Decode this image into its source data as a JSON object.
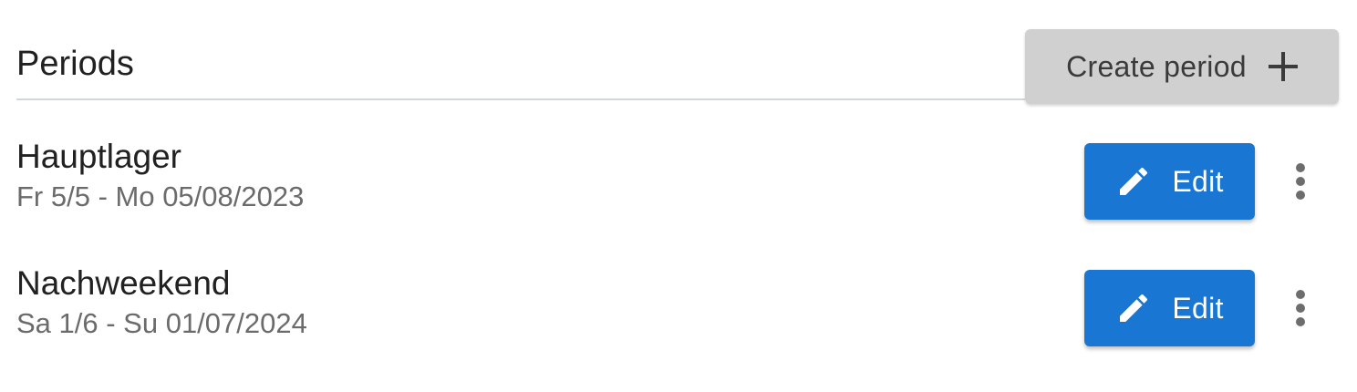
{
  "header": {
    "title": "Periods",
    "create_button_label": "Create period"
  },
  "periods": [
    {
      "name": "Hauptlager",
      "dates": "Fr 5/5 - Mo 05/08/2023",
      "edit_label": "Edit"
    },
    {
      "name": "Nachweekend",
      "dates": "Sa 1/6 - Su 01/07/2024",
      "edit_label": "Edit"
    }
  ],
  "icons": {
    "create": "plus-icon",
    "edit": "pencil-icon",
    "more": "more-vertical-icon"
  },
  "colors": {
    "primary": "#1976d2",
    "create_button_bg": "#d0d0d0",
    "divider": "#cfd8dc",
    "secondary_text": "#6b6b6b"
  }
}
